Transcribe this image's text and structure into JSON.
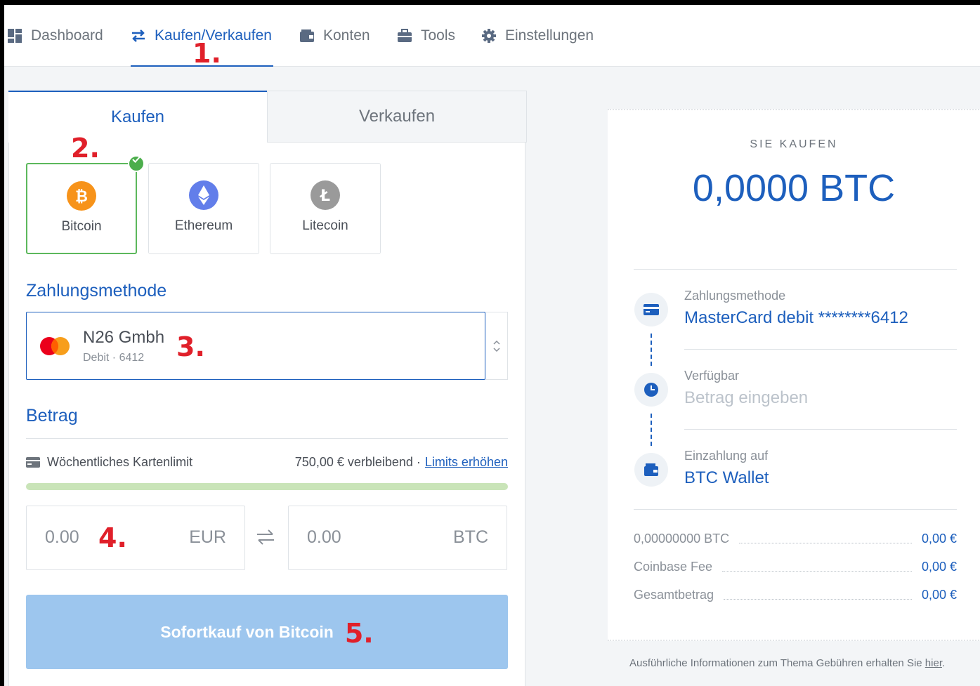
{
  "nav": {
    "dashboard": "Dashboard",
    "buy_sell": "Kaufen/Verkaufen",
    "accounts": "Konten",
    "tools": "Tools",
    "settings": "Einstellungen"
  },
  "annotations": {
    "n1": "1.",
    "n2": "2.",
    "n3": "3.",
    "n4": "4.",
    "n5": "5."
  },
  "tabs": {
    "buy": "Kaufen",
    "sell": "Verkaufen"
  },
  "coins": [
    {
      "label": "Bitcoin",
      "icon": "bitcoin-icon",
      "color": "#f7931a",
      "selected": true
    },
    {
      "label": "Ethereum",
      "icon": "ethereum-icon",
      "color": "#627eea",
      "selected": false
    },
    {
      "label": "Litecoin",
      "icon": "litecoin-icon",
      "color": "#9a9a9a",
      "selected": false
    }
  ],
  "payment": {
    "title": "Zahlungsmethode",
    "name": "N26 Gmbh",
    "sub": "Debit · 6412"
  },
  "amount": {
    "title": "Betrag",
    "limit_label": "Wöchentliches Kartenlimit",
    "limit_remaining": "750,00 € verbleibend ·",
    "limit_link": "Limits erhöhen",
    "limit_fill_fraction": 1.0,
    "eur_value": "0.00",
    "eur_currency": "EUR",
    "btc_value": "0.00",
    "btc_currency": "BTC"
  },
  "buy_button": "Sofortkauf von Bitcoin",
  "summary": {
    "label": "SIE KAUFEN",
    "amount": "0,0000 BTC",
    "steps": [
      {
        "label": "Zahlungsmethode",
        "value": "MasterCard debit ********6412",
        "icon": "card-icon"
      },
      {
        "label": "Verfügbar",
        "value": "Betrag eingeben",
        "icon": "clock-icon"
      },
      {
        "label": "Einzahlung auf",
        "value": "BTC Wallet",
        "icon": "wallet-icon"
      }
    ],
    "fees": [
      {
        "label": "0,00000000 BTC",
        "value": "0,00 €"
      },
      {
        "label": "Coinbase Fee",
        "value": "0,00 €"
      },
      {
        "label": "Gesamtbetrag",
        "value": "0,00 €"
      }
    ]
  },
  "footnote": {
    "text": "Ausführliche Informationen zum Thema Gebühren erhalten Sie ",
    "link": "hier",
    "end": "."
  },
  "colors": {
    "accent": "#1d5fbd",
    "success": "#4cae4c",
    "annotation": "#e0202a"
  }
}
